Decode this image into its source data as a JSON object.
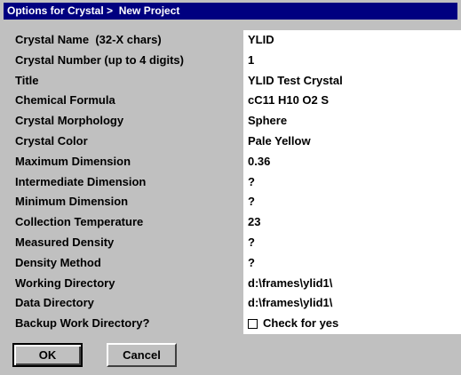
{
  "window": {
    "title": "Options for Crystal >  New Project"
  },
  "fields": [
    {
      "label": "Crystal Name  (32-X chars)",
      "value": "YLID"
    },
    {
      "label": "Crystal Number (up to 4 digits)",
      "value": "1"
    },
    {
      "label": "Title",
      "value": "YLID Test Crystal"
    },
    {
      "label": "Chemical Formula",
      "value": "cC11 H10 O2 S"
    },
    {
      "label": "Crystal Morphology",
      "value": "Sphere"
    },
    {
      "label": "Crystal Color",
      "value": "Pale Yellow"
    },
    {
      "label": "Maximum Dimension",
      "value": "0.36"
    },
    {
      "label": "Intermediate Dimension",
      "value": "?"
    },
    {
      "label": "Minimum Dimension",
      "value": "?"
    },
    {
      "label": "Collection Temperature",
      "value": "23"
    },
    {
      "label": "Measured Density",
      "value": "?"
    },
    {
      "label": "Density Method",
      "value": "?"
    },
    {
      "label": "Working Directory",
      "value": "d:\\frames\\ylid1\\"
    },
    {
      "label": "Data Directory",
      "value": "d:\\frames\\ylid1\\"
    }
  ],
  "backup": {
    "label": "Backup Work Directory?",
    "checkbox_label": "Check for yes",
    "checked": false
  },
  "buttons": {
    "ok_label": "OK",
    "cancel_label": "Cancel"
  },
  "colors": {
    "titlebar": "#000080",
    "dialog_bg": "#c0c0c0",
    "field_bg": "#ffffff"
  }
}
